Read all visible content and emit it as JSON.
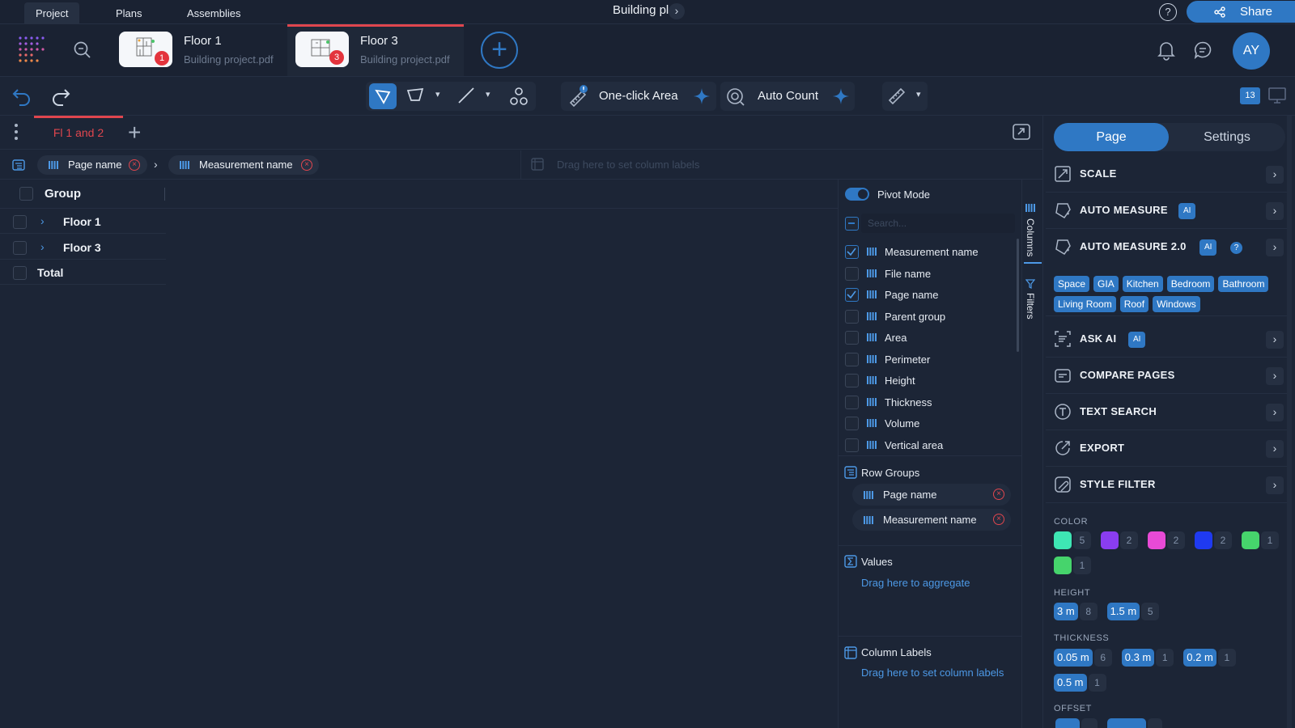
{
  "top": {
    "tabs": [
      {
        "label": "Project"
      },
      {
        "label": "Plans"
      },
      {
        "label": "Assemblies"
      }
    ],
    "title": "Building plan",
    "share": "Share",
    "help": "?"
  },
  "docs": [
    {
      "name": "Floor 1",
      "file": "Building project.pdf",
      "badge": "1"
    },
    {
      "name": "Floor 3",
      "file": "Building project.pdf",
      "badge": "3"
    }
  ],
  "user": {
    "initials": "AY"
  },
  "toolbar": {
    "one_click": "One-click Area",
    "auto_count": "Auto Count",
    "page_count": "13"
  },
  "sheet": {
    "tab": "Fl 1 and 2"
  },
  "rowgroups_bar": {
    "chips": [
      {
        "label": "Page name"
      },
      {
        "label": "Measurement name"
      }
    ],
    "drop": "Drag here to set column labels"
  },
  "grid": {
    "header": "Group",
    "rows": [
      {
        "label": "Floor 1"
      },
      {
        "label": "Floor 3"
      }
    ],
    "total": "Total"
  },
  "panel": {
    "pivot": "Pivot Mode",
    "search_placeholder": "Search...",
    "columns": [
      {
        "label": "Measurement name",
        "checked": true
      },
      {
        "label": "File name",
        "checked": false
      },
      {
        "label": "Page name",
        "checked": true
      },
      {
        "label": "Parent group",
        "checked": false
      },
      {
        "label": "Area",
        "checked": false
      },
      {
        "label": "Perimeter",
        "checked": false
      },
      {
        "label": "Height",
        "checked": false
      },
      {
        "label": "Thickness",
        "checked": false
      },
      {
        "label": "Volume",
        "checked": false
      },
      {
        "label": "Vertical area",
        "checked": false
      }
    ],
    "row_groups": "Row Groups",
    "row_group_items": [
      {
        "label": "Page name"
      },
      {
        "label": "Measurement name"
      }
    ],
    "values": "Values",
    "values_hint": "Drag here to aggregate",
    "col_labels": "Column Labels",
    "col_labels_hint": "Drag here to set column labels",
    "side_columns": "Columns",
    "side_filters": "Filters"
  },
  "right": {
    "seg_page": "Page",
    "seg_settings": "Settings",
    "items": [
      {
        "label": "SCALE"
      },
      {
        "label": "AUTO MEASURE",
        "ai": "AI"
      },
      {
        "label": "AUTO MEASURE 2.0",
        "ai": "AI"
      },
      {
        "label": "ASK AI",
        "ai": "AI"
      },
      {
        "label": "COMPARE PAGES"
      },
      {
        "label": "TEXT SEARCH"
      },
      {
        "label": "EXPORT"
      },
      {
        "label": "STYLE FILTER"
      }
    ],
    "tags": [
      "Space",
      "GIA",
      "Kitchen",
      "Bedroom",
      "Bathroom",
      "Living Room",
      "Roof",
      "Windows"
    ],
    "color_label": "COLOR",
    "colors": [
      {
        "hex": "#3ee6b4",
        "count": "5"
      },
      {
        "hex": "#8a3df0",
        "count": "2"
      },
      {
        "hex": "#e84ad6",
        "count": "2"
      },
      {
        "hex": "#1f3af0",
        "count": "2"
      },
      {
        "hex": "#46d46c",
        "count": "1"
      },
      {
        "hex": "#46d46c",
        "count": "1"
      }
    ],
    "height_label": "HEIGHT",
    "heights": [
      {
        "v": "3 m",
        "c": "8"
      },
      {
        "v": "1.5 m",
        "c": "5"
      }
    ],
    "thickness_label": "THICKNESS",
    "thicknesses": [
      {
        "v": "0.05 m",
        "c": "6"
      },
      {
        "v": "0.3 m",
        "c": "1"
      },
      {
        "v": "0.2 m",
        "c": "1"
      },
      {
        "v": "0.5 m",
        "c": "1"
      }
    ],
    "offset_label": "OFFSET"
  }
}
